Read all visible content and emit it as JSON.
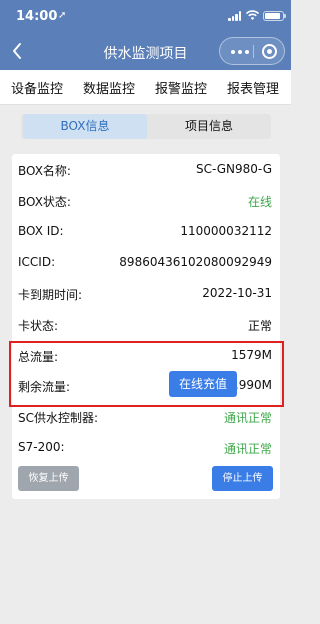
{
  "status_bar": {
    "time": "14:00",
    "location_icon": "location-arrow-icon",
    "signal_icon": "cellular-signal-icon",
    "wifi_icon": "wifi-icon",
    "battery_icon": "battery-icon"
  },
  "navbar": {
    "title": "供水监测项目",
    "back_icon": "chevron-left-icon",
    "more_icon": "more-dots-icon",
    "close_icon": "target-icon"
  },
  "top_tabs": [
    "设备监控",
    "数据监控",
    "报警监控",
    "报表管理"
  ],
  "segment": {
    "tab_box": "BOX信息",
    "tab_project": "项目信息",
    "active": "BOX信息"
  },
  "box_info": {
    "name_label": "BOX名称:",
    "name_value": "SC-GN980-G",
    "status_label": "BOX状态:",
    "status_value": "在线",
    "id_label": "BOX ID:",
    "id_value": "110000032112",
    "iccid_label": "ICCID:",
    "iccid_value": "89860436102080092949",
    "expiry_label": "卡到期时间:",
    "expiry_value": "2022-10-31",
    "card_status_label": "卡状态:",
    "card_status_value": "正常",
    "total_flow_label": "总流量:",
    "total_flow_value": "1579M",
    "remaining_flow_label": "剩余流量:",
    "remaining_flow_value": "1321.990M",
    "recharge_button": "在线充值",
    "sc_controller_label": "SC供水控制器:",
    "sc_controller_value": "通讯正常",
    "s7_label": "S7-200:",
    "s7_value": "通讯正常"
  },
  "actions": {
    "restore_upload": "恢复上传",
    "stop_upload": "停止上传"
  },
  "colors": {
    "header": "#5b80b9",
    "green_status": "#3ea84a",
    "primary_button": "#3a7de6",
    "disabled_button": "#a0a6ad",
    "highlight_border": "#e02020",
    "active_segment_bg": "#cfe0f3"
  }
}
